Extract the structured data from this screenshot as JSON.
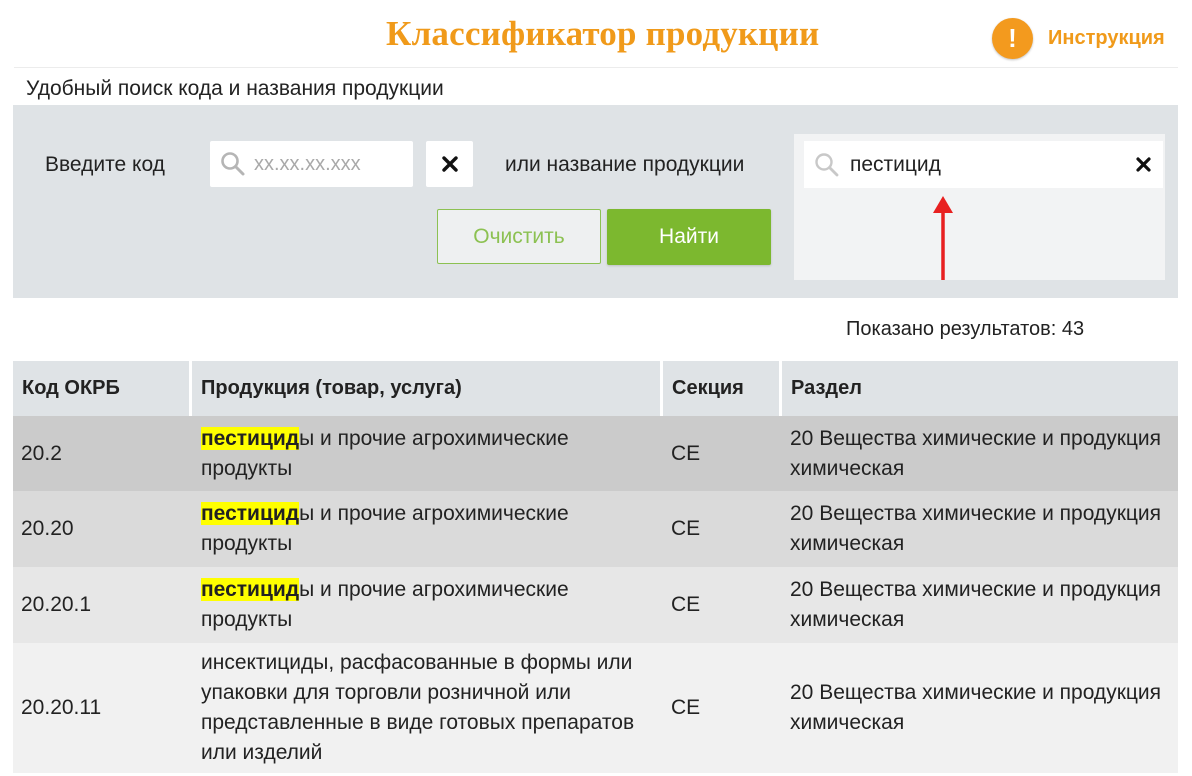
{
  "header": {
    "title": "Классификатор продукции",
    "help_label": "Инструкция",
    "help_icon": "exclamation-circle-icon",
    "accent_color": "#f09a1a"
  },
  "subtitle": "Удобный поиск кода и названия продукции",
  "search": {
    "code_label": "Введите код",
    "code_placeholder": "xx.xx.xx.xxx",
    "code_value": "",
    "name_label": "или название продукции",
    "name_value": "пестицид",
    "clear_button": "Очистить",
    "find_button": "Найти",
    "button_color": "#7cb82f"
  },
  "results_count": "Показано результатов: 43",
  "table": {
    "columns": [
      "Код ОКРБ",
      "Продукция (товар, услуга)",
      "Секция",
      "Раздел"
    ],
    "rows": [
      {
        "code": "20.2",
        "product_highlight": "пестицид",
        "product_rest": "ы и прочие агрохимические продукты",
        "section": "CE",
        "division": "20 Вещества химические и продукция химическая"
      },
      {
        "code": "20.20",
        "product_highlight": "пестицид",
        "product_rest": "ы и прочие агрохимические продукты",
        "section": "CE",
        "division": "20 Вещества химические и продукция химическая"
      },
      {
        "code": "20.20.1",
        "product_highlight": "пестицид",
        "product_rest": "ы и прочие агрохимические продукты",
        "section": "CE",
        "division": "20 Вещества химические и продукция химическая"
      },
      {
        "code": "20.20.11",
        "product_highlight": "",
        "product_rest": "инсектициды, расфасованные в формы или упаковки для торговли розничной или представленные в виде готовых препаратов или изделий",
        "section": "CE",
        "division": "20 Вещества химические и продукция химическая"
      }
    ]
  }
}
